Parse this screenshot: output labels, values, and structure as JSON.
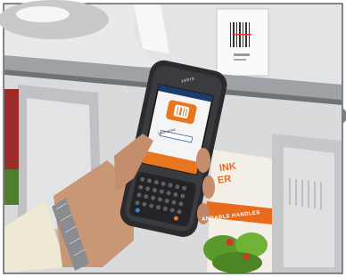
{
  "device": {
    "brand": "zebra",
    "screen_field_label": "Lastname"
  },
  "shelf_sign": {
    "line_1": "INK",
    "line_2": "ER",
    "band_text": "ANDABLE HANDLES"
  },
  "colors": {
    "screen_orange": "#e8761f",
    "screen_white": "#f4f4f4",
    "device_body": "#2b2b2d",
    "shelf_grey": "#d7d8da",
    "skin": "#c99676",
    "sign_orange": "#e96a1c",
    "sign_green": "#5a9a2c"
  }
}
